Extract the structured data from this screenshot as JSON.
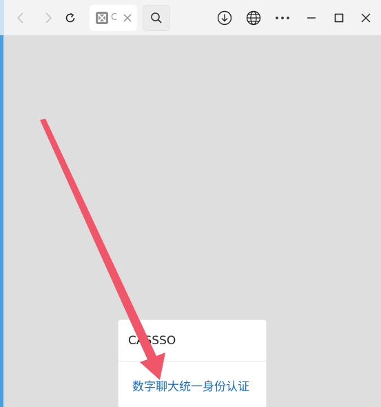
{
  "browser": {
    "tab": {
      "title": "C",
      "favicon": "app-icon"
    },
    "icons": {
      "back": "chevron-left-icon",
      "forward": "chevron-right-icon",
      "refresh": "refresh-icon",
      "close_tab": "close-icon",
      "search": "search-icon",
      "download": "download-icon",
      "globe": "globe-icon",
      "more": "more-icon",
      "minimize": "minimize-icon",
      "maximize": "maximize-icon",
      "close_window": "close-icon"
    }
  },
  "card": {
    "title": "CASSSO",
    "link": "数字聊大统一身份认证"
  },
  "colors": {
    "page_background": "#dedede",
    "link": "#1e6fb8",
    "arrow": "#f0566a",
    "accent_border": "#4a9fe0"
  }
}
